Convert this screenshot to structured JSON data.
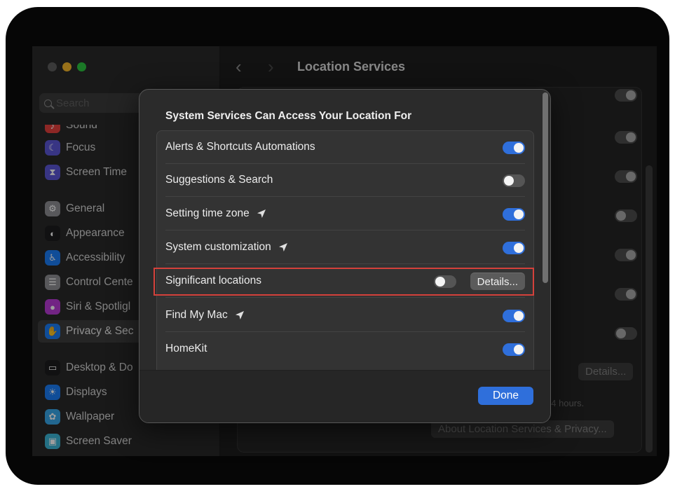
{
  "sidebar": {
    "search_placeholder": "Search",
    "items": [
      {
        "label": "Sound",
        "icon": "speaker-icon",
        "color": "#e4403c"
      },
      {
        "label": "Focus",
        "icon": "moon-icon",
        "color": "#5b56d6"
      },
      {
        "label": "Screen Time",
        "icon": "hourglass-icon",
        "color": "#5b56d6"
      },
      {
        "label": "General",
        "icon": "gear-icon",
        "color": "#8e8e93"
      },
      {
        "label": "Appearance",
        "icon": "appearance-icon",
        "color": "#1c1c1e"
      },
      {
        "label": "Accessibility",
        "icon": "accessibility-icon",
        "color": "#1a7cf5"
      },
      {
        "label": "Control Cente",
        "icon": "control-center-icon",
        "color": "#8e8e93"
      },
      {
        "label": "Siri & Spotligl",
        "icon": "siri-icon",
        "color": "#b93ad6"
      },
      {
        "label": "Privacy & Sec",
        "icon": "hand-icon",
        "color": "#1a7cf5"
      },
      {
        "label": "Desktop & Do",
        "icon": "dock-icon",
        "color": "#1c1c1e"
      },
      {
        "label": "Displays",
        "icon": "sun-icon",
        "color": "#1a7cf5"
      },
      {
        "label": "Wallpaper",
        "icon": "wallpaper-icon",
        "color": "#37a7e8"
      },
      {
        "label": "Screen Saver",
        "icon": "screen-saver-icon",
        "color": "#3bb5d6"
      }
    ]
  },
  "toolbar": {
    "title": "Location Services"
  },
  "background": {
    "details_label": "Details...",
    "note": "24 hours.",
    "about_label": "About Location Services & Privacy..."
  },
  "modal": {
    "title": "System Services Can Access Your Location For",
    "rows": [
      {
        "label": "Alerts & Shortcuts Automations",
        "on": true,
        "location_arrow": false
      },
      {
        "label": "Suggestions & Search",
        "on": false,
        "location_arrow": false
      },
      {
        "label": "Setting time zone",
        "on": true,
        "location_arrow": true
      },
      {
        "label": "System customization",
        "on": true,
        "location_arrow": true
      },
      {
        "label": "Significant locations",
        "on": false,
        "location_arrow": false,
        "details": "Details..."
      },
      {
        "label": "Find My Mac",
        "on": true,
        "location_arrow": true
      },
      {
        "label": "HomeKit",
        "on": true,
        "location_arrow": false
      }
    ],
    "done_label": "Done"
  },
  "colors": {
    "accent": "#2f6fdb",
    "highlight": "#d4413b"
  }
}
